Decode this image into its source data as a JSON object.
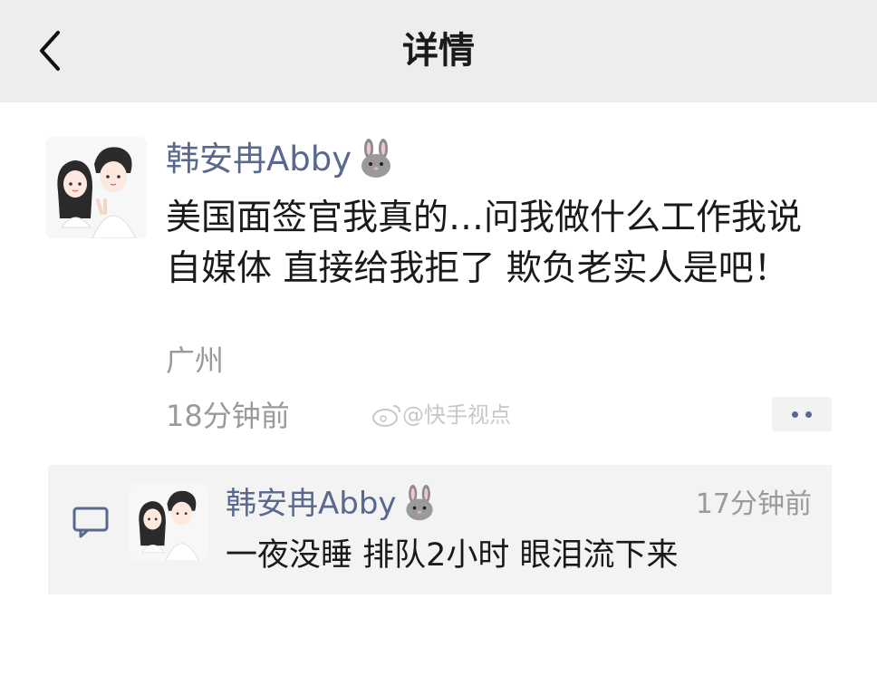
{
  "header": {
    "title": "详情",
    "back_icon": "chevron-left-icon"
  },
  "post": {
    "author": "韩安冉Abby",
    "author_emoji": "rabbit-face-icon",
    "text": "美国面签官我真的…问我做什么工作我说自媒体 直接给我拒了 欺负老实人是吧！",
    "location": "广州",
    "time": "18分钟前",
    "more_icon": "more-dots-icon"
  },
  "watermark": {
    "text": "@快手视点",
    "icon": "weibo-logo-icon"
  },
  "comment": {
    "author": "韩安冉Abby",
    "time": "17分钟前",
    "text": "一夜没睡 排队2小时 眼泪流下来",
    "icon": "comment-icon"
  },
  "colors": {
    "header_bg": "#ededed",
    "author_link": "#58688f",
    "secondary_text": "#9a9a9a",
    "comment_bg": "#f3f3f3"
  }
}
